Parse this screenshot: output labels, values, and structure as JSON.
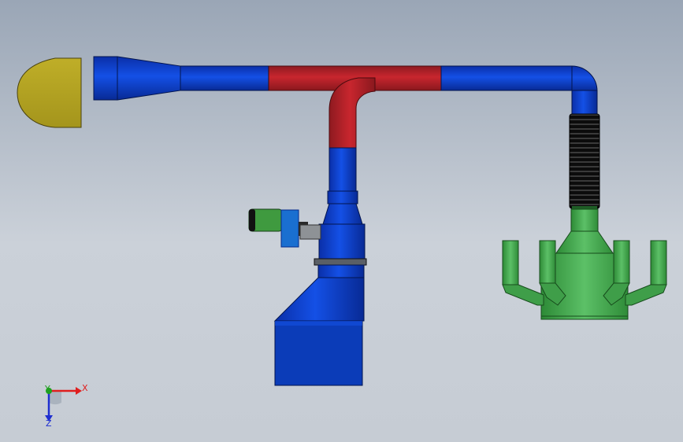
{
  "viewport": {
    "background_top": "#9aa6b6",
    "background_bottom": "#c9cfd7"
  },
  "colors": {
    "duct_blue": "#0a3fc9",
    "duct_blue_dark": "#062b8c",
    "duct_red": "#b4232a",
    "hood_olive": "#b0a020",
    "collector_green": "#3fa34a",
    "motor_green": "#3f9a3f",
    "flex_hose": "#1c1c1c"
  },
  "triad": {
    "x_label": "X",
    "y_label": "Y",
    "z_label": "Z",
    "x_color": "#e01e1e",
    "y_color": "#1ea01e",
    "z_color": "#1e2ed0"
  }
}
